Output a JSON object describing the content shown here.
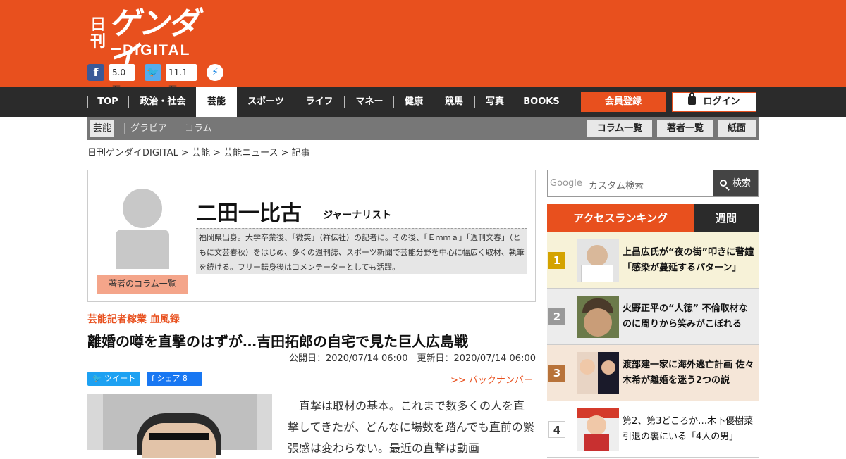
{
  "logo": {
    "nikkan": "日刊",
    "gendai": "ゲンダイ",
    "digital": "DIGITAL"
  },
  "social": {
    "facebook_count": "5.0万",
    "twitter_count": "11.1万"
  },
  "nav": {
    "items": [
      "TOP",
      "政治・社会",
      "芸能",
      "スポーツ",
      "ライフ",
      "マネー",
      "健康",
      "競馬",
      "写真",
      "BOOKS"
    ],
    "register": "会員登録",
    "login": "ログイン"
  },
  "subnav": {
    "items": [
      "芸能",
      "グラビア",
      "コラム"
    ],
    "right": [
      "コラム一覧",
      "著者一覧",
      "紙面"
    ]
  },
  "breadcrumb": "日刊ゲンダイDIGITAL > 芸能 > 芸能ニュース > 記事",
  "author": {
    "name": "二田一比古",
    "role": "ジャーナリスト",
    "bio": "福岡県出身。大学卒業後、「微笑」（祥伝社）の記者に。その後、「Ｅｍｍａ」「週刊文春」（ともに文芸春秋）をはじめ、多くの週刊誌、スポーツ新聞で芸能分野を中心に幅広く取材、執筆を続ける。フリー転身後はコメンテーターとしても活躍。",
    "column_button": "著者のコラム一覧"
  },
  "article": {
    "series": "芸能記者稼業 血風録",
    "title": "離婚の噂を直撃のはずが…吉田拓郎の自宅で見た巨人広島戦",
    "dates": "公開日：2020/07/14 06:00　更新日：2020/07/14 06:00",
    "tweet": "ツイート",
    "share": "シェア 8",
    "back_number": ">> バックナンバー",
    "body": "直撃は取材の基本。これまで数多くの人を直撃してきたが、どんなに場数を踏んでも直前の緊張感は変わらない。最近の直撃は動画"
  },
  "search": {
    "google": "Google",
    "placeholder": "カスタム検索",
    "button": "検索"
  },
  "ranking": {
    "title": "アクセスランキング",
    "tab": "週間",
    "items": [
      {
        "rank": "1",
        "text": "上昌広氏が“夜の街”叩きに警鐘「感染が蔓延するパターン」"
      },
      {
        "rank": "2",
        "text": "火野正平の“人徳” 不倫取材なのに周りから笑みがこぼれる"
      },
      {
        "rank": "3",
        "text": "渡部建一家に海外逃亡計画 佐々木希が離婚を迷う2つの説"
      },
      {
        "rank": "4",
        "text": "第2、第3どころか…木下優樹菜引退の裏にいる「4人の男」"
      }
    ]
  }
}
